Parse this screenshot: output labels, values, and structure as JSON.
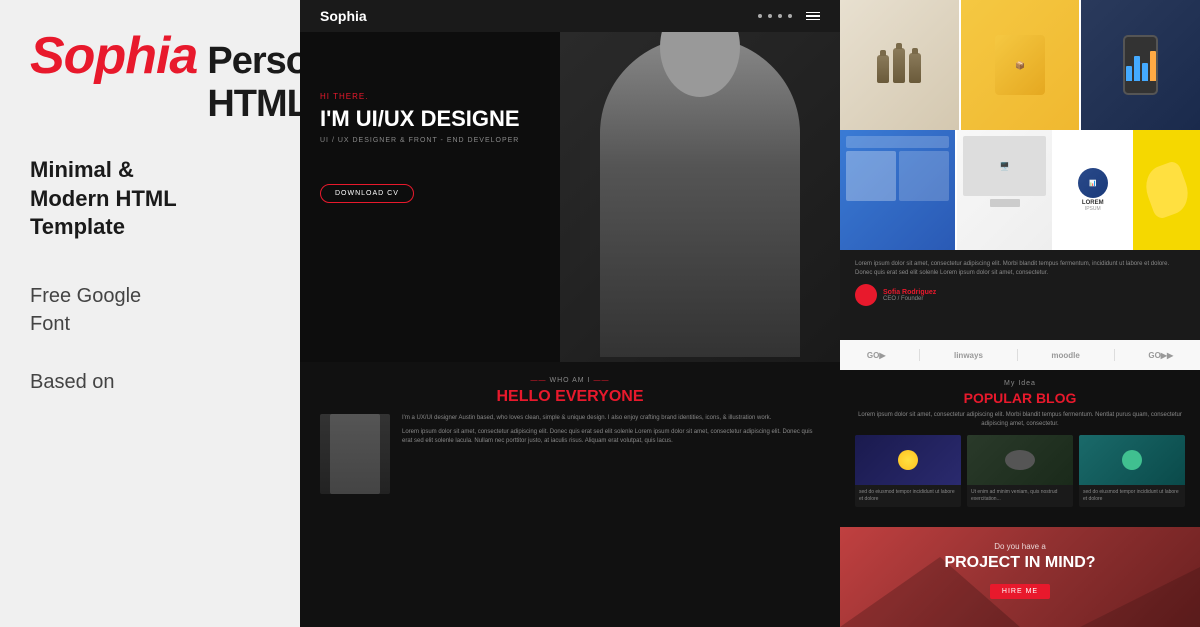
{
  "brand": {
    "name_red": "Sophia",
    "name_black": "Personal HTML"
  },
  "tagline": {
    "line1": "Minimal &",
    "line2": "Modern HTML",
    "line3": "Template"
  },
  "features": [
    {
      "label": "Free Google\nFont"
    },
    {
      "label": "Based on"
    }
  ],
  "mockup": {
    "logo": "Sophia",
    "hero": {
      "hi_there": "HI THERE.",
      "title": "I'M UI/UX DESIGNE",
      "subtitle": "UI / UX DESIGNER & FRONT - END DEVELOPER",
      "button": "DOWNLOAD CV"
    },
    "about": {
      "who_label": "Who am I",
      "title": "HELLO EVERYONE",
      "paragraph1": "I'm a UX/UI designer Austin based, who loves clean, simple & unique design. I also enjoy crafting brand identities, icons, & illustration work.",
      "paragraph2": "Lorem ipsum dolor sit amet, consectetur adipiscing elit. Donec quis erat sed elit solenle Lorem ipsum dolor sit amet, consectetur adipiscing elit. Donec quis erat sed elit solenle lacula. Nullam nec porttitor justo, at iaculis risus. Aliquam erat volutpat, quis lacus.",
      "paragraph3": "Lorem ipsum dolor sit amet."
    },
    "blog": {
      "my_idea_label": "My Idea",
      "title": "POPULAR BLOG",
      "intro": "Lorem ipsum dolor sit amet, consectetur adipiscing elit. Morbi blandit tempus fermentum. Nentlat purus quam, consectetur adipiscing amet, consectetur.",
      "posts": [
        {
          "meta": "sed do eiusmod tempor incididunt ut labore et dolore",
          "text": "Ut enim ad minim veniam, quis nostrud exercitation..."
        },
        {
          "meta": "sed do eiusmod tempor incididunt ut labore et dolore",
          "text": ""
        },
        {
          "meta": "sed do eiusmod tempor incididunt ut labore et dolore",
          "text": ""
        }
      ]
    },
    "cta": {
      "question": "Do you have a",
      "title": "PROJECT IN MIND?",
      "button": "HIRE ME"
    },
    "partners": [
      "GO▶",
      "linways",
      "moodle",
      "GO▶▶"
    ],
    "testimonial": {
      "text": "Lorem ipsum dolor sit amet, consectetur adipiscing elit. Morbi blandit tempus fermentum, incididunt ut labore et dolore. Donec quis erat sed elit solenle Lorem ipsum dolor sit amet, consectetur.",
      "author_name": "Sofia Rodriguez",
      "author_role": "CEO / Founder"
    }
  }
}
